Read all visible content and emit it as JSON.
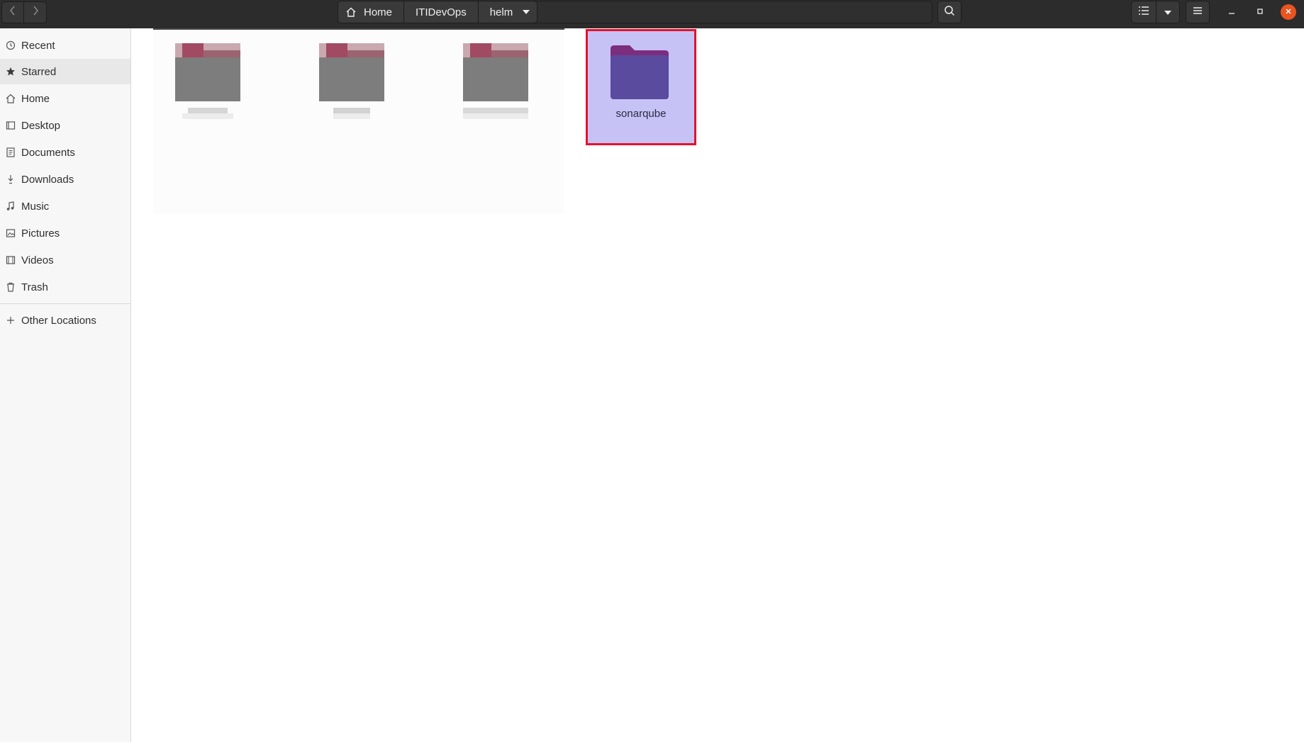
{
  "header": {
    "breadcrumbs": [
      "Home",
      "ITIDevOps",
      "helm"
    ],
    "icons": {
      "back": "chevron-left-icon",
      "forward": "chevron-right-icon",
      "search": "search-icon",
      "list_view": "list-view-icon",
      "view_options": "chevron-down-icon",
      "menu": "hamburger-menu-icon",
      "minimize": "minimize-icon",
      "maximize": "maximize-icon",
      "close": "close-icon"
    },
    "close_color": "#e95420"
  },
  "sidebar": {
    "items": [
      {
        "label": "Recent",
        "icon": "clock-icon"
      },
      {
        "label": "Starred",
        "icon": "star-icon"
      },
      {
        "label": "Home",
        "icon": "home-icon"
      },
      {
        "label": "Desktop",
        "icon": "desktop-icon"
      },
      {
        "label": "Documents",
        "icon": "document-icon"
      },
      {
        "label": "Downloads",
        "icon": "download-icon"
      },
      {
        "label": "Music",
        "icon": "music-icon"
      },
      {
        "label": "Pictures",
        "icon": "picture-icon"
      },
      {
        "label": "Videos",
        "icon": "video-icon"
      },
      {
        "label": "Trash",
        "icon": "trash-icon"
      },
      {
        "label": "Other Locations",
        "icon": "plus-icon"
      }
    ],
    "active": "Starred"
  },
  "content": {
    "selected_folder": {
      "label": "sonarqube",
      "icon": "folder-icon"
    },
    "selection_color": "#c7c2f6",
    "highlight_border_color": "#e5112c"
  }
}
